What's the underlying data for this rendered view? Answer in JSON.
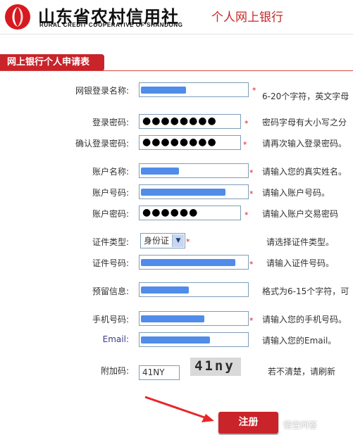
{
  "header": {
    "brand_cn": "山东省农村信用社",
    "brand_en": "RURAL CREDIT COOPERATIVE OF SHANDONG",
    "bank_title": "个人网上银行"
  },
  "section_title": "网上银行个人申请表",
  "form": {
    "login_name": {
      "label": "网银登录名称:",
      "hint": "6-20个字符，英文字母"
    },
    "login_pwd": {
      "label": "登录密码:",
      "value": "●●●●●●●●",
      "hint": "密码字母有大小写之分"
    },
    "confirm_pwd": {
      "label": "确认登录密码:",
      "value": "●●●●●●●●",
      "hint": "请再次输入登录密码。"
    },
    "account_name": {
      "label": "账户名称:",
      "hint": "请输入您的真实姓名。"
    },
    "account_no": {
      "label": "账户号码:",
      "hint": "请输入账户号码。"
    },
    "account_pwd": {
      "label": "账户密码:",
      "value": "●●●●●●",
      "hint": "请输入账户交易密码"
    },
    "id_type": {
      "label": "证件类型:",
      "value": "身份证",
      "hint": "请选择证件类型。"
    },
    "id_no": {
      "label": "证件号码:",
      "hint": "请输入证件号码。"
    },
    "reserved": {
      "label": "预留信息:",
      "hint": "格式为6-15个字符，可"
    },
    "mobile": {
      "label": "手机号码:",
      "hint": "请输入您的手机号码。"
    },
    "email": {
      "label": "Email:",
      "hint": "请输入您的Email。"
    },
    "captcha": {
      "label": "附加码:",
      "value": "41NY",
      "image_text": "41ny",
      "hint": "若不清楚，请刷新"
    },
    "required_mark": "*"
  },
  "submit_label": "注册",
  "watermark": "悟空问答",
  "colors": {
    "brand_red": "#c8242a",
    "field_border": "#7f9db9",
    "redaction_blue": "#3d7fe8"
  }
}
